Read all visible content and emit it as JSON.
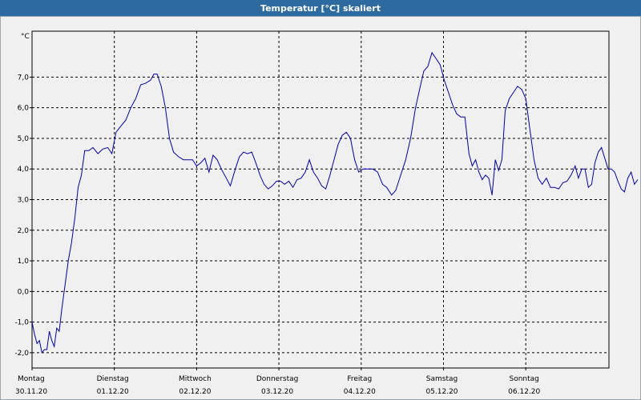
{
  "window": {
    "title": "Temperatur [°C] skaliert"
  },
  "colors": {
    "series": "#0000aa",
    "grid": "#000000",
    "title_bg": "#2d6aa0"
  },
  "chart_data": {
    "type": "line",
    "title": "Temperatur [°C] skaliert",
    "ylabel": "°C",
    "ylim": [
      -2.5,
      8.5
    ],
    "yticks": [
      -2.0,
      -1.0,
      0.0,
      1.0,
      2.0,
      3.0,
      4.0,
      5.0,
      6.0,
      7.0
    ],
    "ytick_labels": [
      "-2,0",
      "-1,0",
      "0,0",
      "1,0",
      "2,0",
      "3,0",
      "4,0",
      "5,0",
      "6,0",
      "7,0"
    ],
    "xlim": [
      0,
      7
    ],
    "xticks": [
      {
        "x": 0,
        "day": "Montag",
        "date": "30.11.20"
      },
      {
        "x": 1,
        "day": "Dienstag",
        "date": "01.12.20"
      },
      {
        "x": 2,
        "day": "Mittwoch",
        "date": "02.12.20"
      },
      {
        "x": 3,
        "day": "Donnerstag",
        "date": "03.12.20"
      },
      {
        "x": 4,
        "day": "Freitag",
        "date": "04.12.20"
      },
      {
        "x": 5,
        "day": "Samstag",
        "date": "05.12.20"
      },
      {
        "x": 6,
        "day": "Sonntag",
        "date": "06.12.20"
      }
    ],
    "grid": true,
    "series": [
      {
        "points": [
          [
            0.0,
            -1.0
          ],
          [
            0.03,
            -1.4
          ],
          [
            0.06,
            -1.7
          ],
          [
            0.09,
            -1.6
          ],
          [
            0.12,
            -2.0
          ],
          [
            0.15,
            -1.9
          ],
          [
            0.18,
            -1.9
          ],
          [
            0.21,
            -1.3
          ],
          [
            0.24,
            -1.6
          ],
          [
            0.27,
            -1.8
          ],
          [
            0.3,
            -1.2
          ],
          [
            0.33,
            -1.3
          ],
          [
            0.36,
            -0.6
          ],
          [
            0.4,
            0.2
          ],
          [
            0.44,
            1.0
          ],
          [
            0.48,
            1.6
          ],
          [
            0.52,
            2.4
          ],
          [
            0.56,
            3.4
          ],
          [
            0.6,
            3.8
          ],
          [
            0.64,
            4.6
          ],
          [
            0.69,
            4.6
          ],
          [
            0.74,
            4.7
          ],
          [
            0.8,
            4.5
          ],
          [
            0.86,
            4.65
          ],
          [
            0.92,
            4.7
          ],
          [
            0.97,
            4.5
          ],
          [
            1.02,
            5.2
          ],
          [
            1.08,
            5.4
          ],
          [
            1.14,
            5.6
          ],
          [
            1.2,
            6.0
          ],
          [
            1.26,
            6.3
          ],
          [
            1.32,
            6.75
          ],
          [
            1.38,
            6.8
          ],
          [
            1.44,
            6.9
          ],
          [
            1.48,
            7.1
          ],
          [
            1.52,
            7.1
          ],
          [
            1.57,
            6.7
          ],
          [
            1.62,
            6.0
          ],
          [
            1.67,
            5.0
          ],
          [
            1.72,
            4.55
          ],
          [
            1.78,
            4.4
          ],
          [
            1.84,
            4.3
          ],
          [
            1.9,
            4.3
          ],
          [
            1.95,
            4.3
          ],
          [
            2.0,
            4.1
          ],
          [
            2.05,
            4.2
          ],
          [
            2.1,
            4.35
          ],
          [
            2.15,
            3.9
          ],
          [
            2.2,
            4.45
          ],
          [
            2.25,
            4.3
          ],
          [
            2.3,
            4.0
          ],
          [
            2.36,
            3.7
          ],
          [
            2.41,
            3.45
          ],
          [
            2.47,
            4.0
          ],
          [
            2.52,
            4.4
          ],
          [
            2.57,
            4.55
          ],
          [
            2.62,
            4.5
          ],
          [
            2.67,
            4.55
          ],
          [
            2.72,
            4.2
          ],
          [
            2.77,
            3.8
          ],
          [
            2.82,
            3.5
          ],
          [
            2.87,
            3.35
          ],
          [
            2.92,
            3.45
          ],
          [
            2.97,
            3.6
          ],
          [
            3.02,
            3.6
          ],
          [
            3.07,
            3.5
          ],
          [
            3.12,
            3.6
          ],
          [
            3.17,
            3.4
          ],
          [
            3.22,
            3.65
          ],
          [
            3.27,
            3.7
          ],
          [
            3.32,
            3.9
          ],
          [
            3.37,
            4.3
          ],
          [
            3.42,
            3.9
          ],
          [
            3.47,
            3.7
          ],
          [
            3.52,
            3.45
          ],
          [
            3.57,
            3.35
          ],
          [
            3.62,
            3.8
          ],
          [
            3.67,
            4.3
          ],
          [
            3.72,
            4.8
          ],
          [
            3.77,
            5.1
          ],
          [
            3.82,
            5.2
          ],
          [
            3.87,
            5.0
          ],
          [
            3.92,
            4.3
          ],
          [
            3.97,
            3.9
          ],
          [
            4.02,
            4.0
          ],
          [
            4.08,
            4.0
          ],
          [
            4.14,
            4.0
          ],
          [
            4.2,
            3.9
          ],
          [
            4.26,
            3.5
          ],
          [
            4.31,
            3.4
          ],
          [
            4.37,
            3.15
          ],
          [
            4.42,
            3.3
          ],
          [
            4.48,
            3.8
          ],
          [
            4.54,
            4.3
          ],
          [
            4.6,
            5.0
          ],
          [
            4.66,
            6.0
          ],
          [
            4.71,
            6.6
          ],
          [
            4.76,
            7.2
          ],
          [
            4.81,
            7.35
          ],
          [
            4.86,
            7.8
          ],
          [
            4.91,
            7.6
          ],
          [
            4.96,
            7.4
          ],
          [
            5.01,
            6.9
          ],
          [
            5.06,
            6.5
          ],
          [
            5.11,
            6.1
          ],
          [
            5.16,
            5.8
          ],
          [
            5.21,
            5.7
          ],
          [
            5.26,
            5.7
          ],
          [
            5.31,
            4.5
          ],
          [
            5.35,
            4.1
          ],
          [
            5.39,
            4.3
          ],
          [
            5.43,
            3.9
          ],
          [
            5.47,
            3.65
          ],
          [
            5.51,
            3.8
          ],
          [
            5.55,
            3.7
          ],
          [
            5.59,
            3.15
          ],
          [
            5.63,
            4.3
          ],
          [
            5.67,
            3.95
          ],
          [
            5.71,
            4.3
          ],
          [
            5.75,
            5.9
          ],
          [
            5.8,
            6.3
          ],
          [
            5.85,
            6.5
          ],
          [
            5.9,
            6.7
          ],
          [
            5.95,
            6.6
          ],
          [
            6.0,
            6.3
          ],
          [
            6.05,
            5.3
          ],
          [
            6.1,
            4.3
          ],
          [
            6.15,
            3.7
          ],
          [
            6.2,
            3.5
          ],
          [
            6.25,
            3.7
          ],
          [
            6.3,
            3.4
          ],
          [
            6.35,
            3.4
          ],
          [
            6.4,
            3.35
          ],
          [
            6.45,
            3.55
          ],
          [
            6.5,
            3.6
          ],
          [
            6.55,
            3.8
          ],
          [
            6.6,
            4.1
          ],
          [
            6.64,
            3.7
          ],
          [
            6.68,
            4.0
          ],
          [
            6.72,
            4.0
          ],
          [
            6.76,
            3.4
          ],
          [
            6.8,
            3.5
          ],
          [
            6.84,
            4.2
          ],
          [
            6.88,
            4.55
          ],
          [
            6.92,
            4.7
          ],
          [
            6.96,
            4.35
          ],
          [
            7.0,
            4.0
          ],
          [
            7.04,
            4.0
          ],
          [
            7.08,
            3.9
          ],
          [
            7.12,
            3.6
          ],
          [
            7.16,
            3.35
          ],
          [
            7.2,
            3.25
          ],
          [
            7.24,
            3.7
          ],
          [
            7.28,
            3.9
          ],
          [
            7.32,
            3.5
          ],
          [
            7.36,
            3.65
          ]
        ]
      }
    ]
  }
}
